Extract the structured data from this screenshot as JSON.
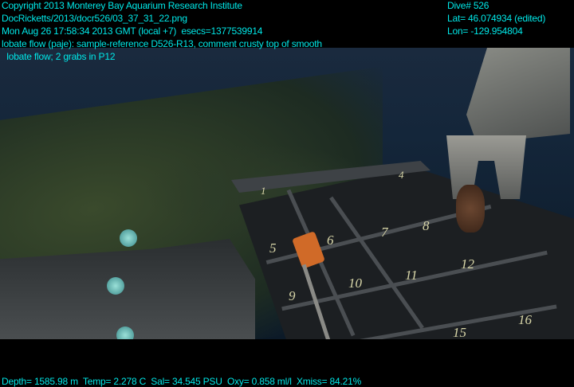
{
  "overlay": {
    "left_lines": [
      "Copyright 2013 Monterey Bay Aquarium Research Institute",
      "DocRicketts/2013/docr526/03_37_31_22.png",
      "Mon Aug 26 17:58:34 2013 GMT (local +7)  esecs=1377539914",
      "lobate flow (paje): sample-reference D526-R13, comment crusty top of smooth",
      "  lobate flow; 2 grabs in P12"
    ],
    "right_lines": [
      "Dive# 526",
      "Lat= 46.074934 (edited)",
      "Lon= -129.954804"
    ],
    "bottom_line": "Depth= 1585.98 m  Temp= 2.278 C  Sal= 34.545 PSU  Oxy= 0.858 ml/l  Xmiss= 84.21%"
  },
  "crate_labels": [
    "1",
    "4",
    "5",
    "6",
    "7",
    "8",
    "9",
    "10",
    "11",
    "12",
    "15",
    "16"
  ],
  "colors": {
    "overlay_text": "#00e8e8"
  }
}
